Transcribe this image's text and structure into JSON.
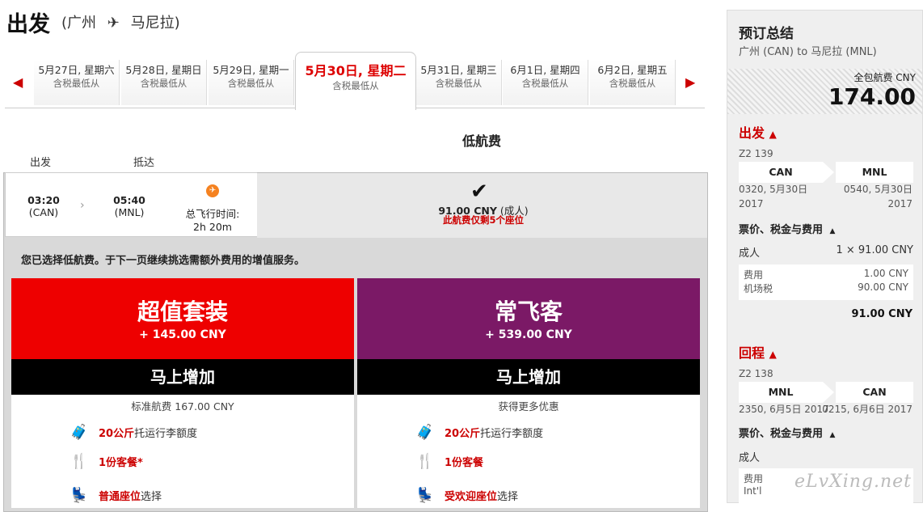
{
  "header": {
    "title": "出发",
    "route_from": "(广州",
    "route_to": "马尼拉)",
    "plane_icon": "plane-icon"
  },
  "dates": [
    {
      "date": "5月27日, 星期六",
      "sub": "含税最低从"
    },
    {
      "date": "5月28日, 星期日",
      "sub": "含税最低从"
    },
    {
      "date": "5月29日, 星期一",
      "sub": "含税最低从"
    },
    {
      "date": "5月30日, 星期二",
      "sub": "含税最低从"
    },
    {
      "date": "5月31日, 星期三",
      "sub": "含税最低从"
    },
    {
      "date": "6月1日, 星期四",
      "sub": "含税最低从"
    },
    {
      "date": "6月2日, 星期五",
      "sub": "含税最低从"
    }
  ],
  "fare_header": "低航费",
  "col_labels": {
    "depart": "出发",
    "arrive": "抵达"
  },
  "flight": {
    "dep_time": "03:20",
    "dep_code": "(CAN)",
    "arr_time": "05:40",
    "arr_code": "(MNL)",
    "duration_label": "总飞行时间:",
    "duration": "2h 20m"
  },
  "fare": {
    "price": "91.00 CNY",
    "suffix": "(成人)",
    "seats": "此航费仅剩5个座位"
  },
  "notice": "您已选择低航费。于下一页继续挑选需额外费用的增值服务。",
  "packages": [
    {
      "name": "超值套装",
      "price": "+ 145.00 CNY",
      "button": "马上增加",
      "sub": "标准航费 167.00 CNY",
      "color": "#ee0000",
      "features": [
        {
          "hl": "20公斤",
          "text": " 托运行李额度",
          "icon": "luggage-icon"
        },
        {
          "hl": "1份客餐*",
          "text": "",
          "icon": "meal-icon"
        },
        {
          "hl": "普通座位",
          "text": " 选择",
          "icon": "seat-icon"
        }
      ]
    },
    {
      "name": "常飞客",
      "price": "+ 539.00 CNY",
      "button": "马上增加",
      "sub": "获得更多优惠",
      "color": "#7b1966",
      "features": [
        {
          "hl": "20公斤",
          "text": "托运行李额度",
          "icon": "luggage-icon"
        },
        {
          "hl": "1份客餐",
          "text": "",
          "icon": "meal-icon"
        },
        {
          "hl": "受欢迎座位",
          "text": " 选择",
          "icon": "seat-icon"
        }
      ]
    }
  ],
  "summary": {
    "title": "预订总结",
    "route": "广州 (CAN) to 马尼拉 (MNL)",
    "total_label": "全包航费 CNY",
    "total": "174.00",
    "out": {
      "title": "出发",
      "flight": "Z2 139",
      "from": "CAN",
      "to": "MNL",
      "dep": "0320, 5月30日",
      "dep_year": "2017",
      "arr": "0540, 5月30日",
      "arr_year": "2017"
    },
    "fees_title": "票价、税金与费用",
    "adult": "成人",
    "adult_calc": "1 × 91.00 CNY",
    "fee1_label": "费用",
    "fee1": "1.00 CNY",
    "fee2_label": "机场税",
    "fee2": "90.00 CNY",
    "subtotal": "91.00 CNY",
    "ret": {
      "title": "回程",
      "flight": "Z2 138",
      "from": "MNL",
      "to": "CAN",
      "dep": "2350, 6月5日 2017",
      "arr": "0215, 6月6日 2017"
    },
    "fees_title2": "票价、税金与费用",
    "adult2": "成人",
    "fee3_label": "费用",
    "fee4_label": "Int'l"
  },
  "watermark": "eLvXing.net"
}
